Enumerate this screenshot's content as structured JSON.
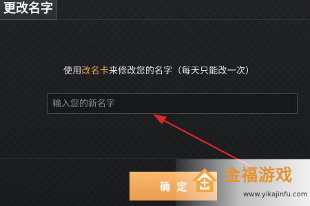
{
  "dialog": {
    "title": "更改名字",
    "instruction": {
      "prefix": "使用",
      "highlight": "改名卡",
      "suffix": "来修改您的名字（每天只能改一次）"
    },
    "name_input": {
      "value": "",
      "placeholder": "输入您的新名字"
    },
    "confirm_label": "确 定"
  },
  "watermark": {
    "name": "金福游戏",
    "url": "www.yikajinfu.com"
  },
  "colors": {
    "highlight": "#e9a84f",
    "button": "#f3aa5b",
    "arrow": "#e02424",
    "logo_orange": "#e6922b"
  },
  "icons": {
    "annotation": "red-arrow-icon",
    "watermark_logo": "house-logo-icon"
  }
}
